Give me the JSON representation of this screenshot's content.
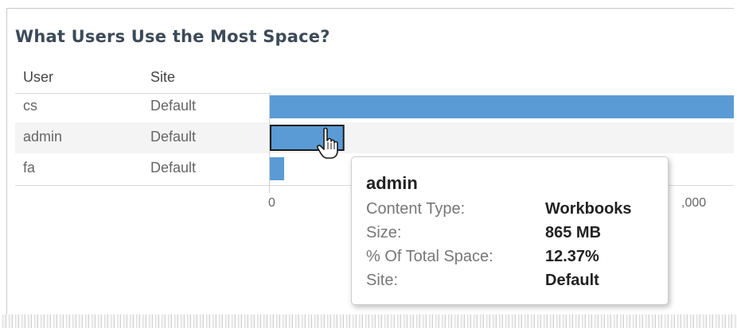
{
  "title": "What Users Use the Most Space?",
  "columns": {
    "user": "User",
    "site": "Site"
  },
  "rows": [
    {
      "user": "cs",
      "site": "Default"
    },
    {
      "user": "admin",
      "site": "Default"
    },
    {
      "user": "fa",
      "site": "Default"
    }
  ],
  "chart_data": {
    "type": "bar",
    "orientation": "horizontal",
    "categories": [
      "cs",
      "admin",
      "fa"
    ],
    "values": [
      5600,
      865,
      170
    ],
    "selected": "admin",
    "x_ticks": [
      "0",
      ",000"
    ],
    "bar_color": "#5b9bd5",
    "grid": false
  },
  "tooltip": {
    "title": "admin",
    "fields": [
      {
        "label": "Content Type:",
        "value": "Workbooks"
      },
      {
        "label": "Size:",
        "value": "865 MB"
      },
      {
        "label": "% Of Total Space:",
        "value": "12.37%"
      },
      {
        "label": "Site:",
        "value": "Default"
      }
    ]
  },
  "icons": {
    "cursor": "hand-pointer-icon"
  }
}
